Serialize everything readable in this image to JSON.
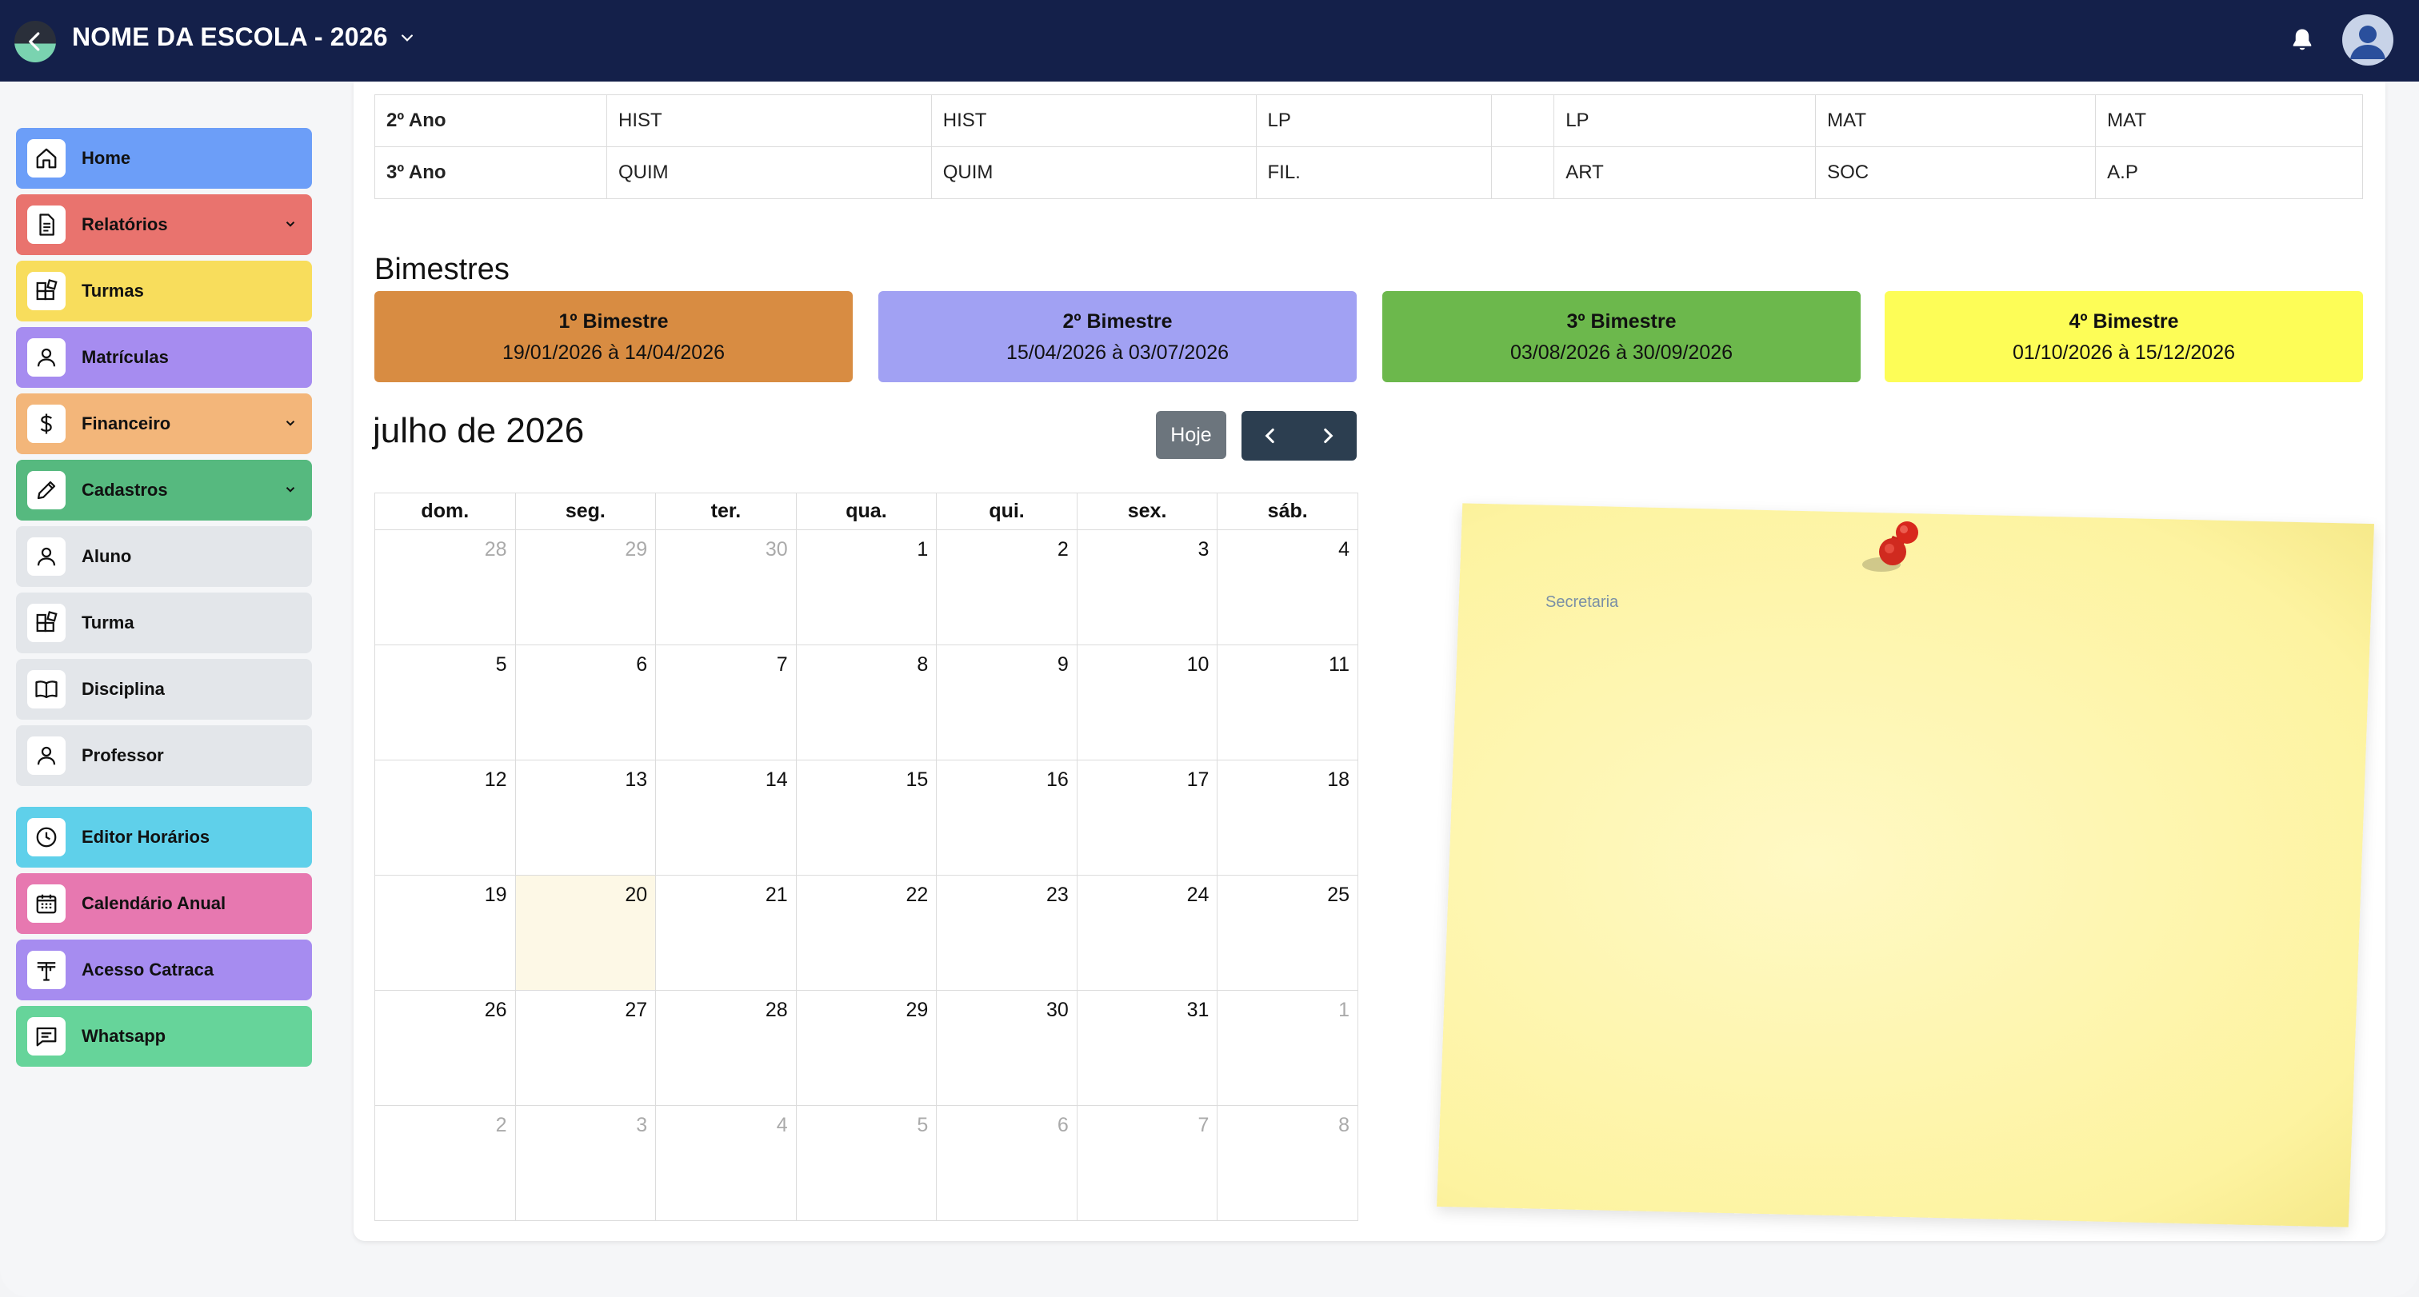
{
  "app": {
    "title": "NOME DA ESCOLA -  2026"
  },
  "colors": {
    "topbar": "#14204a",
    "home": "#6c9ef8",
    "relatorios": "#e9736e",
    "turmas": "#f8dd5c",
    "matriculas": "#a68cf0",
    "financeiro": "#f3b67a",
    "cadastros": "#56b97f",
    "sub": "#e3e6ea",
    "editor": "#5fd0ea",
    "calendario": "#e778b0",
    "catraca": "#a68cf0",
    "whatsapp": "#66d49a"
  },
  "sidebar": {
    "items": [
      {
        "label": "Home",
        "icon": "home-icon"
      },
      {
        "label": "Relatórios",
        "icon": "document-icon",
        "has_submenu": true
      },
      {
        "label": "Turmas",
        "icon": "grid-icon"
      },
      {
        "label": "Matrículas",
        "icon": "user-icon"
      },
      {
        "label": "Financeiro",
        "icon": "dollar-icon",
        "has_submenu": true
      },
      {
        "label": "Cadastros",
        "icon": "pencil-icon",
        "has_submenu": true,
        "expanded": true
      },
      {
        "label": "Aluno",
        "icon": "user-icon"
      },
      {
        "label": "Turma",
        "icon": "grid-icon"
      },
      {
        "label": "Disciplina",
        "icon": "book-icon"
      },
      {
        "label": "Professor",
        "icon": "user-icon"
      },
      {
        "label": "Editor Horários",
        "icon": "clock-icon"
      },
      {
        "label": "Calendário Anual",
        "icon": "calendar-icon"
      },
      {
        "label": "Acesso Catraca",
        "icon": "turnstile-icon"
      },
      {
        "label": "Whatsapp",
        "icon": "chat-icon"
      }
    ]
  },
  "schedule": {
    "rows": [
      {
        "name": "2º Ano",
        "cells": [
          "HIST",
          "HIST",
          "LP",
          "",
          "LP",
          "MAT",
          "MAT"
        ]
      },
      {
        "name": "3º Ano",
        "cells": [
          "QUIM",
          "QUIM",
          "FIL.",
          "",
          "ART",
          "SOC",
          "A.P"
        ]
      }
    ]
  },
  "bimestres": {
    "title": "Bimestres",
    "items": [
      {
        "name": "1º Bimestre",
        "dates": "19/01/2026 à 14/04/2026",
        "color": "#d88c42"
      },
      {
        "name": "2º Bimestre",
        "dates": "15/04/2026 à 03/07/2026",
        "color": "#a1a1f3"
      },
      {
        "name": "3º Bimestre",
        "dates": "03/08/2026 à 30/09/2026",
        "color": "#6cb84c"
      },
      {
        "name": "4º Bimestre",
        "dates": "01/10/2026 à 15/12/2026",
        "color": "#fdfd57"
      }
    ]
  },
  "calendar": {
    "month_title": "julho de 2026",
    "today_label": "Hoje",
    "weekdays": [
      "dom.",
      "seg.",
      "ter.",
      "qua.",
      "qui.",
      "sex.",
      "sáb."
    ],
    "weeks": [
      [
        "28",
        "29",
        "30",
        "1",
        "2",
        "3",
        "4"
      ],
      [
        "5",
        "6",
        "7",
        "8",
        "9",
        "10",
        "11"
      ],
      [
        "12",
        "13",
        "14",
        "15",
        "16",
        "17",
        "18"
      ],
      [
        "19",
        "20",
        "21",
        "22",
        "23",
        "24",
        "25"
      ],
      [
        "26",
        "27",
        "28",
        "29",
        "30",
        "31",
        "1"
      ],
      [
        "2",
        "3",
        "4",
        "5",
        "6",
        "7",
        "8"
      ]
    ],
    "today": "20"
  },
  "note": {
    "label": "Secretaria"
  }
}
